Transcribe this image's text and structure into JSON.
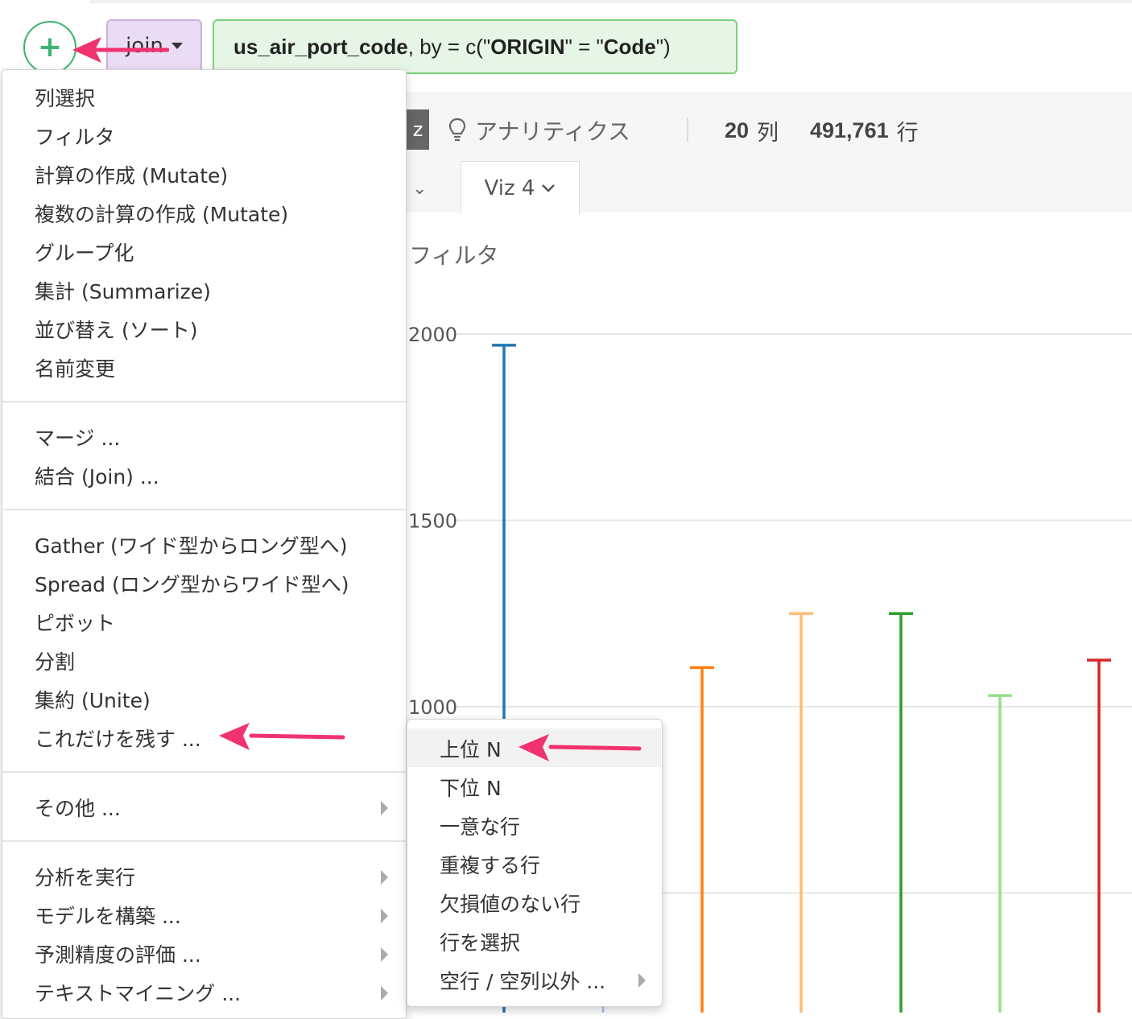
{
  "top": {
    "add_icon_glyph": "+",
    "join_label": "join",
    "code": {
      "p1": "us_air_port_code",
      "p2": ", by = c(\"",
      "p3": "ORIGIN",
      "p4": "\" = \"",
      "p5": "Code",
      "p6": "\")"
    }
  },
  "toolbar": {
    "viz_partial": "z",
    "analytics_label": "アナリティクス",
    "cols_count": "20",
    "cols_unit": "列",
    "rows_count": "491,761",
    "rows_unit": "行",
    "viz_tab": "Viz 4",
    "filter_label": "フィルタ"
  },
  "menu": {
    "group1": [
      "列選択",
      "フィルタ",
      "計算の作成 (Mutate)",
      "複数の計算の作成 (Mutate)",
      "グループ化",
      "集計 (Summarize)",
      "並び替え (ソート)",
      "名前変更"
    ],
    "group2": [
      "マージ ...",
      "結合 (Join) ..."
    ],
    "group3": [
      "Gather (ワイド型からロング型へ)",
      "Spread (ロング型からワイド型へ)",
      "ピボット",
      "分割",
      "集約 (Unite)",
      "これだけを残す ..."
    ],
    "group4": [
      "その他 ..."
    ],
    "group5": [
      "分析を実行",
      "モデルを構築 ...",
      "予測精度の評価 ...",
      "テキストマイニング ..."
    ]
  },
  "submenu": {
    "items": [
      "上位 N",
      "下位 N",
      "一意な行",
      "重複する行",
      "欠損値のない行",
      "行を選択",
      "空行 / 空列以外 ..."
    ]
  },
  "colors": {
    "accent_green": "#3cb371",
    "annotation_pink": "#f0336e"
  },
  "chart_data": {
    "type": "bar",
    "y_ticks": [
      "2000",
      "1500",
      "1000"
    ],
    "series": [
      {
        "color": "#1f77b4",
        "top": 1970
      },
      {
        "color": "#ff7f0e",
        "top": 1105
      },
      {
        "color": "#ffbb78",
        "top": 1250
      },
      {
        "color": "#2ca02c",
        "top": 1250
      },
      {
        "color": "#98df8a",
        "top": 1030
      },
      {
        "color": "#d62728",
        "top": 1125
      }
    ]
  }
}
